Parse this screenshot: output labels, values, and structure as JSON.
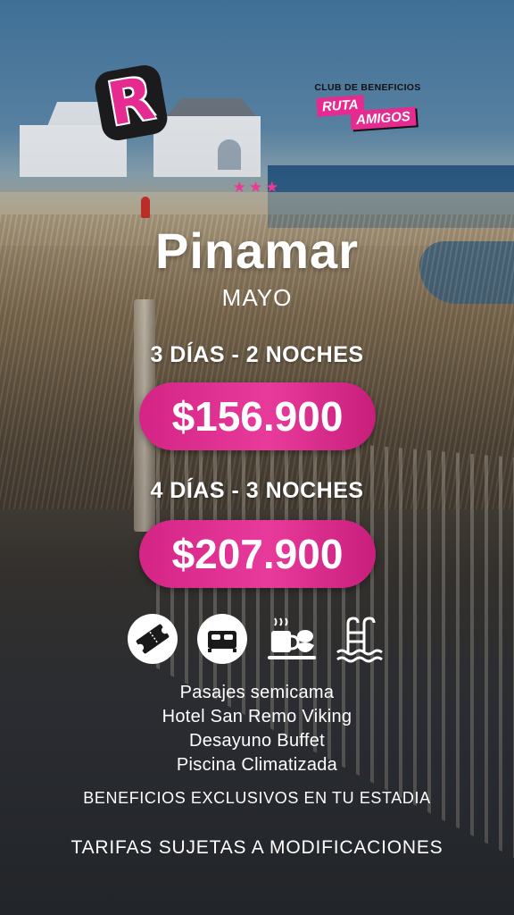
{
  "brand": {
    "logo_letter": "R",
    "club_text": "CLUB DE BENEFICIOS",
    "ruta": "RUTA",
    "amigos": "AMIGOS"
  },
  "stars": "★★★",
  "destination": "Pinamar",
  "month": "MAYO",
  "packages": [
    {
      "duration": "3 DÍAS - 2 NOCHES",
      "price": "$156.900"
    },
    {
      "duration": "4 DÍAS - 3 NOCHES",
      "price": "$207.900"
    }
  ],
  "icons": [
    "ticket-icon",
    "bed-icon",
    "breakfast-icon",
    "pool-icon"
  ],
  "features": [
    "Pasajes semicama",
    "Hotel San Remo Viking",
    "Desayuno Buffet",
    "Piscina Climatizada"
  ],
  "benefits": "BENEFICIOS EXCLUSIVOS EN TU ESTADIA",
  "disclaimer": "TARIFAS SUJETAS A MODIFICACIONES",
  "colors": {
    "accent": "#e52b8f",
    "text": "#ffffff"
  }
}
